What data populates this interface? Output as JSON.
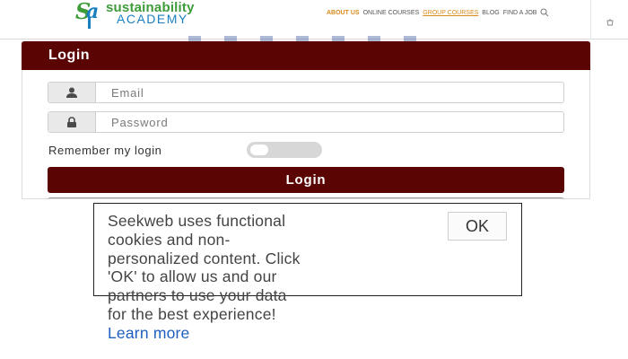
{
  "header": {
    "logo": {
      "mark_s": "S",
      "mark_a": "a",
      "line1": "sustainability",
      "line2": "ACADEMY"
    },
    "nav": [
      {
        "label": "ABOUT US",
        "state": "active"
      },
      {
        "label": "ONLINE COURSES",
        "state": "normal"
      },
      {
        "label": "GROUP COURSES",
        "state": "highlight"
      },
      {
        "label": "BLOG",
        "state": "normal"
      },
      {
        "label": "FIND A JOB",
        "state": "normal"
      }
    ],
    "search_icon": "search-icon",
    "cart_icon": "cart-icon"
  },
  "login": {
    "title": "Login",
    "email_placeholder": "Email",
    "password_placeholder": "Password",
    "remember_label": "Remember my login",
    "remember_on": false,
    "submit_label": "Login",
    "user_icon": "user-icon",
    "lock_icon": "lock-icon"
  },
  "cookie": {
    "line1": "Seekweb uses functional",
    "line2": "cookies and non-",
    "line3": "personalized content. Click",
    "line4": "'OK' to allow us and our",
    "line5": "partners to use your data",
    "line6": "for the best experience!",
    "learn_more": "Learn more",
    "ok_label": "OK"
  },
  "colors": {
    "brand_maroon": "#5b0404",
    "logo_green": "#3e9b3a",
    "logo_blue": "#1a7fbf",
    "nav_orange": "#d98a1c",
    "link_blue": "#1e5fbf"
  }
}
